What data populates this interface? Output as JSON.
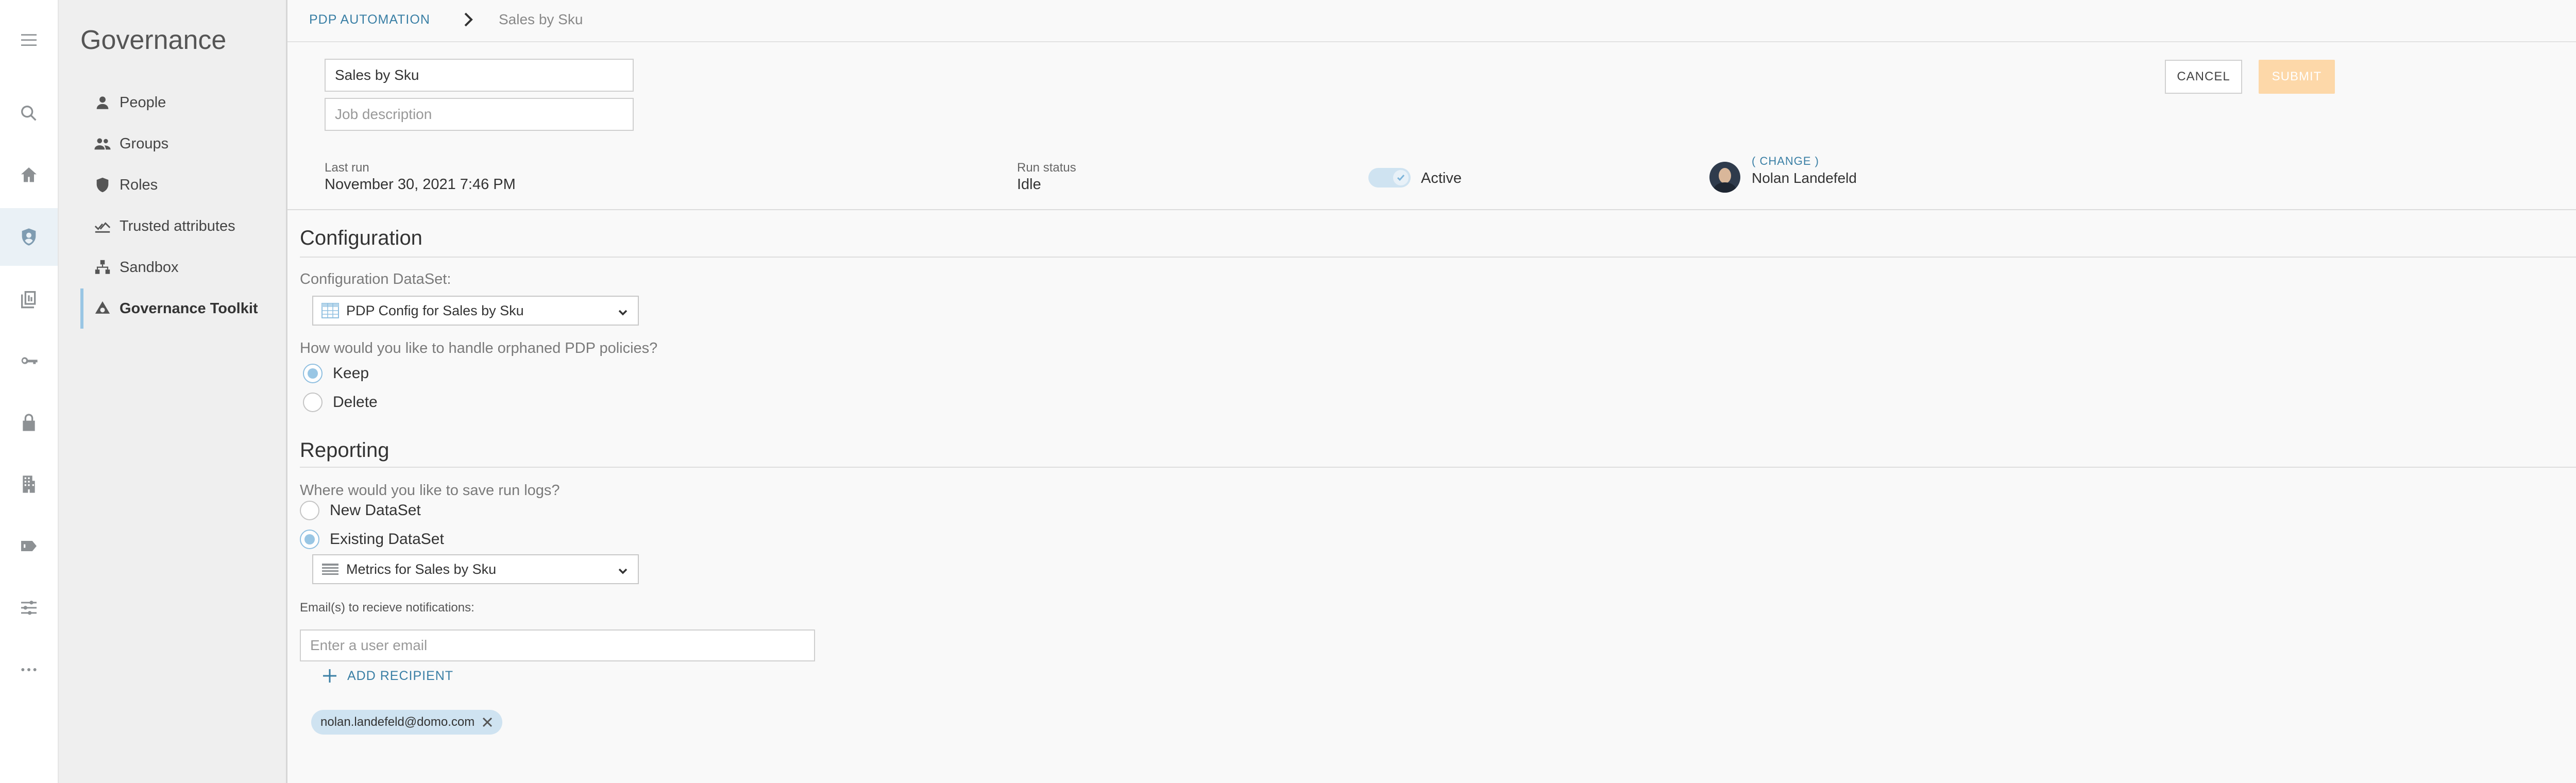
{
  "rail": {
    "items": [
      {
        "icon": "menu-icon"
      },
      {
        "icon": "search-icon"
      },
      {
        "icon": "home-icon"
      },
      {
        "icon": "governance-shield-icon",
        "active": true
      },
      {
        "icon": "datasets-icon"
      },
      {
        "icon": "key-icon"
      },
      {
        "icon": "lock-icon"
      },
      {
        "icon": "building-icon"
      },
      {
        "icon": "tag-icon"
      },
      {
        "icon": "sliders-icon"
      },
      {
        "icon": "more-icon"
      }
    ]
  },
  "sidebar": {
    "title": "Governance",
    "items": [
      {
        "label": "People",
        "icon": "person-icon"
      },
      {
        "label": "Groups",
        "icon": "group-icon"
      },
      {
        "label": "Roles",
        "icon": "shield-icon"
      },
      {
        "label": "Trusted attributes",
        "icon": "trusted-attributes-icon"
      },
      {
        "label": "Sandbox",
        "icon": "sandbox-icon"
      },
      {
        "label": "Governance Toolkit",
        "icon": "toolkit-icon",
        "active": true
      }
    ]
  },
  "breadcrumb": {
    "root": "PDP AUTOMATION",
    "current": "Sales by Sku"
  },
  "job": {
    "name": "Sales by Sku",
    "description_placeholder": "Job description"
  },
  "actions": {
    "cancel": "CANCEL",
    "submit": "SUBMIT"
  },
  "status": {
    "last_run_label": "Last run",
    "last_run_value": "November 30, 2021 7:46 PM",
    "run_status_label": "Run status",
    "run_status_value": "Idle",
    "active_label": "Active",
    "active": true
  },
  "owner": {
    "change_label": "( CHANGE )",
    "name": "Nolan Landefeld"
  },
  "configuration": {
    "title": "Configuration",
    "dataset_label": "Configuration DataSet:",
    "dataset_value": "PDP Config for Sales by Sku",
    "orphan_question": "How would you like to handle orphaned PDP policies?",
    "orphan_options": [
      {
        "label": "Keep",
        "checked": true
      },
      {
        "label": "Delete",
        "checked": false
      }
    ]
  },
  "reporting": {
    "title": "Reporting",
    "logs_question": "Where would you like to save run logs?",
    "log_options": [
      {
        "label": "New DataSet",
        "checked": false
      },
      {
        "label": "Existing DataSet",
        "checked": true
      }
    ],
    "dataset_value": "Metrics for Sales by Sku",
    "email_label": "Email(s) to recieve notifications:",
    "email_placeholder": "Enter a user email",
    "add_recipient": "ADD RECIPIENT",
    "recipients": [
      "nolan.landefeld@domo.com"
    ]
  },
  "colors": {
    "accent": "#3a7fa5",
    "selection": "#99c6e4",
    "submit_disabled": "#fdd8a9"
  }
}
